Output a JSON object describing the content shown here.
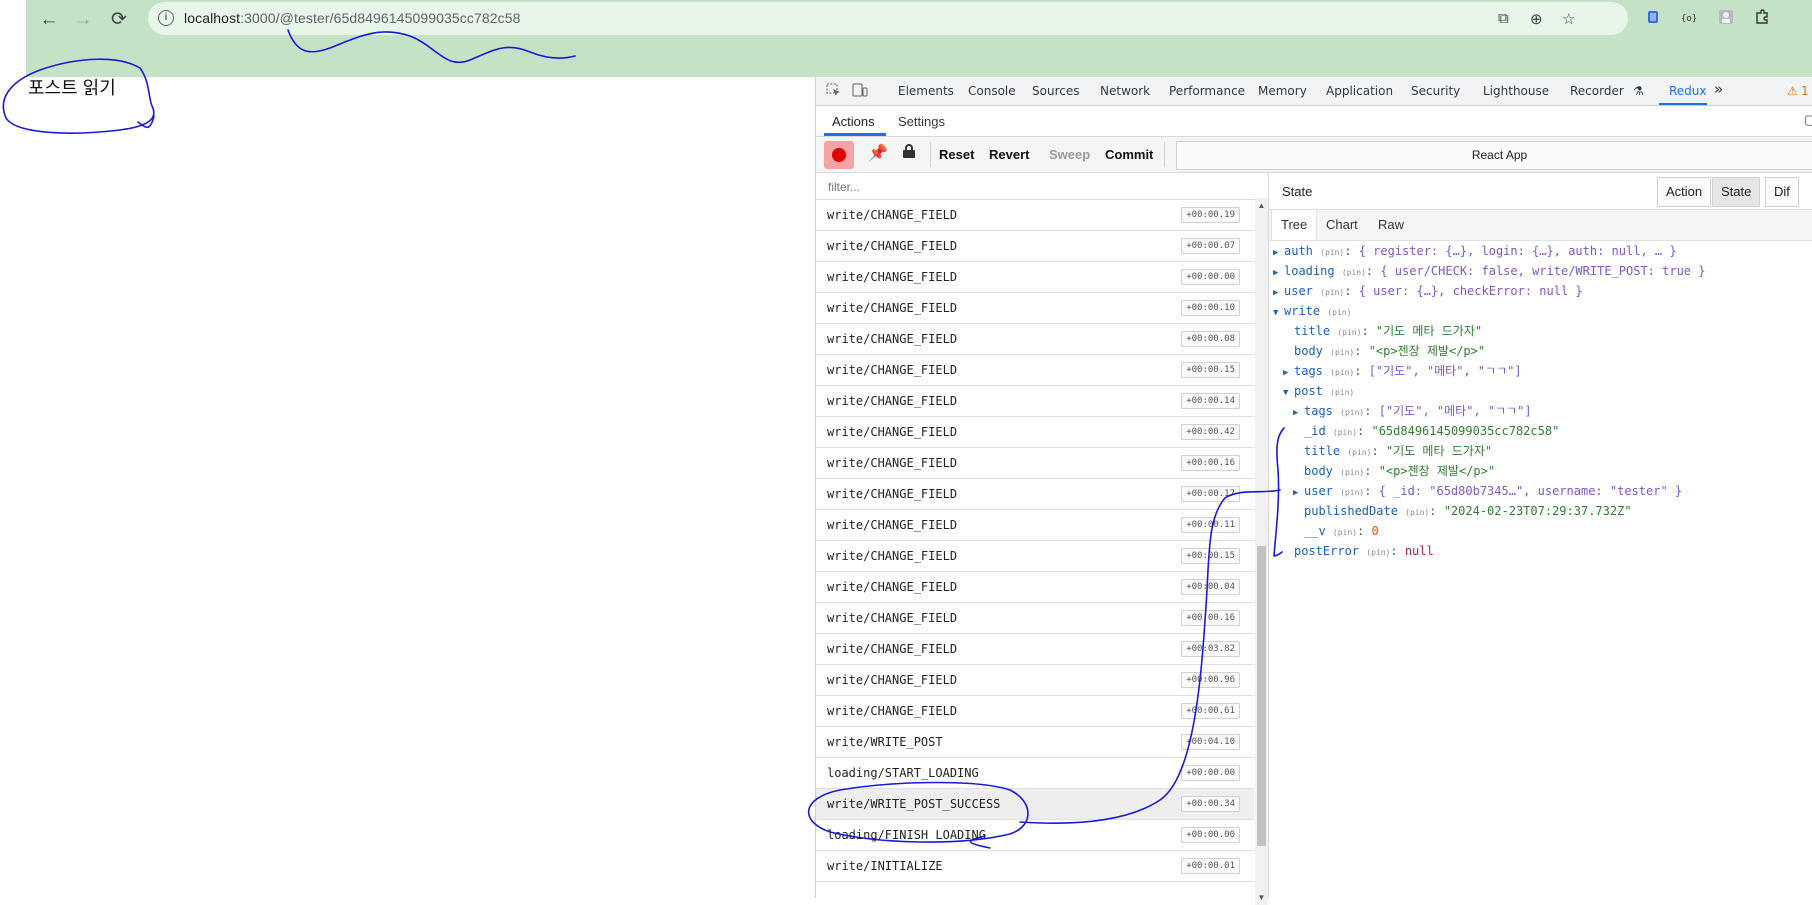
{
  "browser": {
    "url_host": "localhost",
    "url_rest": ":3000/@tester/65d8496145099035cc782c58",
    "nav_back": "←",
    "nav_forward": "→",
    "reload": "⟳"
  },
  "page": {
    "heading": "포스트 읽기"
  },
  "devtools": {
    "tabs": [
      "Elements",
      "Console",
      "Sources",
      "Network",
      "Performance",
      "Memory",
      "Application",
      "Security",
      "Lighthouse",
      "Recorder",
      "Redux"
    ],
    "more": "»",
    "warnings": "1",
    "redux": {
      "subtabs": [
        "Actions",
        "Settings"
      ],
      "toolbar": {
        "reset": "Reset",
        "revert": "Revert",
        "sweep": "Sweep",
        "commit": "Commit",
        "app_name": "React App"
      },
      "filter_placeholder": "filter...",
      "actions": [
        {
          "name": "write/CHANGE_FIELD",
          "time": "+00:00.19"
        },
        {
          "name": "write/CHANGE_FIELD",
          "time": "+00:00.07"
        },
        {
          "name": "write/CHANGE_FIELD",
          "time": "+00:00.00"
        },
        {
          "name": "write/CHANGE_FIELD",
          "time": "+00:00.10"
        },
        {
          "name": "write/CHANGE_FIELD",
          "time": "+00:00.08"
        },
        {
          "name": "write/CHANGE_FIELD",
          "time": "+00:00.15"
        },
        {
          "name": "write/CHANGE_FIELD",
          "time": "+00:00.14"
        },
        {
          "name": "write/CHANGE_FIELD",
          "time": "+00:00.42"
        },
        {
          "name": "write/CHANGE_FIELD",
          "time": "+00:00.16"
        },
        {
          "name": "write/CHANGE_FIELD",
          "time": "+00:00.17"
        },
        {
          "name": "write/CHANGE_FIELD",
          "time": "+00:00.11"
        },
        {
          "name": "write/CHANGE_FIELD",
          "time": "+00:00.15"
        },
        {
          "name": "write/CHANGE_FIELD",
          "time": "+00:00.04"
        },
        {
          "name": "write/CHANGE_FIELD",
          "time": "+00:00.16"
        },
        {
          "name": "write/CHANGE_FIELD",
          "time": "+00:03.82"
        },
        {
          "name": "write/CHANGE_FIELD",
          "time": "+00:00.96"
        },
        {
          "name": "write/CHANGE_FIELD",
          "time": "+00:00.61"
        },
        {
          "name": "write/WRITE_POST",
          "time": "+00:04.10"
        },
        {
          "name": "loading/START_LOADING",
          "time": "+00:00.00"
        },
        {
          "name": "write/WRITE_POST_SUCCESS",
          "time": "+00:00.34"
        },
        {
          "name": "loading/FINISH_LOADING",
          "time": "+00:00.00"
        },
        {
          "name": "write/INITIALIZE",
          "time": "+00:00.01"
        }
      ],
      "state_title": "State",
      "monitor_buttons": [
        "Action",
        "State",
        "Dif"
      ],
      "view_tabs": [
        "Tree",
        "Chart",
        "Raw"
      ],
      "pin": "(pin)",
      "tree": {
        "auth_key": "auth",
        "auth_preview": "{ register: {…}, login: {…}, auth: null, … }",
        "loading_key": "loading",
        "loading_preview": "{ user/CHECK: false, write/WRITE_POST: true }",
        "user_key": "user",
        "user_preview": "{ user: {…}, checkError: null }",
        "write_key": "write",
        "write_title_key": "title",
        "write_title": "\"기도 메타 드가자\"",
        "write_body_key": "body",
        "write_body": "\"<p>젠장 제발</p>\"",
        "write_tags_key": "tags",
        "write_tags": "[\"기도\", \"메타\", \"ㄱㄱ\"]",
        "post_key": "post",
        "post_tags_key": "tags",
        "post_tags": "[\"기도\", \"메타\", \"ㄱㄱ\"]",
        "post_id_key": "_id",
        "post_id": "\"65d8496145099035cc782c58\"",
        "post_title_key": "title",
        "post_title": "\"기도 메타 드가자\"",
        "post_body_key": "body",
        "post_body": "\"<p>젠장 제발</p>\"",
        "post_user_key": "user",
        "post_user": "{ _id: \"65d80b7345…\", username: \"tester\" }",
        "post_date_key": "publishedDate",
        "post_date": "\"2024-02-23T07:29:37.732Z\"",
        "post_v_key": "__v",
        "post_v": "0",
        "post_error_key": "postError",
        "post_error": "null"
      }
    }
  },
  "colors": {
    "chrome_bar": "#c4e2c6",
    "accent": "#1a73e8",
    "annotation_ink": "#1a1ad6"
  }
}
